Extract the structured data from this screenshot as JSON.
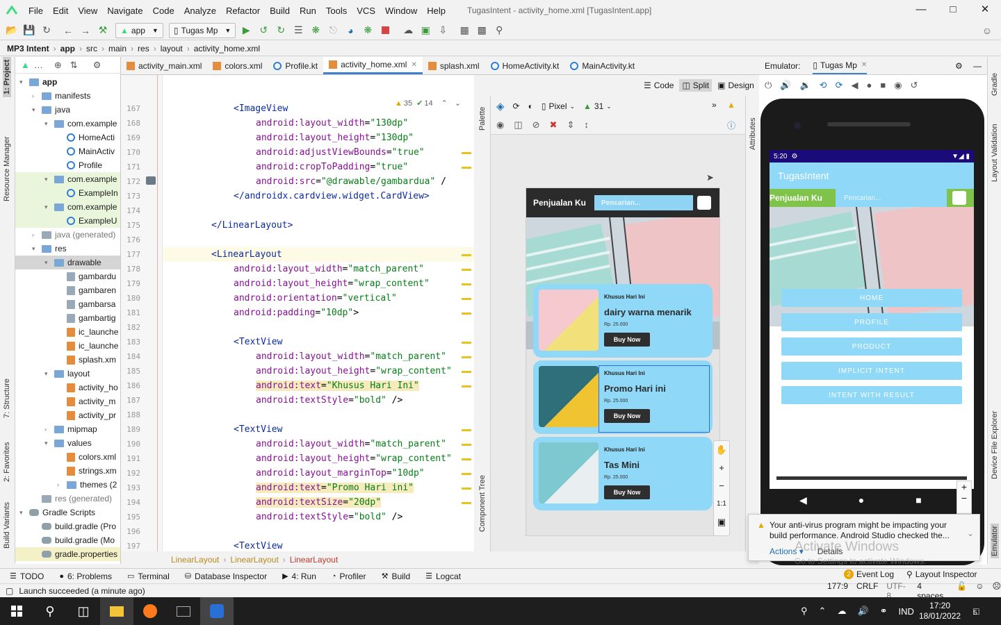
{
  "window": {
    "title": "TugasIntent - activity_home.xml [TugasIntent.app]"
  },
  "menu": [
    "File",
    "Edit",
    "View",
    "Navigate",
    "Code",
    "Analyze",
    "Refactor",
    "Build",
    "Run",
    "Tools",
    "VCS",
    "Window",
    "Help"
  ],
  "toolbar": {
    "module": "app",
    "run_config": "Tugas Mp"
  },
  "breadcrumb": [
    "MP3 Intent",
    "app",
    "src",
    "main",
    "res",
    "layout",
    "activity_home.xml"
  ],
  "left_strip": [
    "1: Project",
    "Resource Manager",
    "7: Structure",
    "2: Favorites",
    "Build Variants"
  ],
  "right_strip": [
    "Gradle",
    "Layout Validation",
    "Device File Explorer",
    "Emulator"
  ],
  "tree": [
    {
      "label": "app",
      "depth": 0,
      "kind": "fold",
      "bold": true,
      "arrow": "▾"
    },
    {
      "label": "manifests",
      "depth": 1,
      "kind": "fold",
      "arrow": "›"
    },
    {
      "label": "java",
      "depth": 1,
      "kind": "fold",
      "arrow": "▾"
    },
    {
      "label": "com.example",
      "depth": 2,
      "kind": "fold",
      "arrow": "▾"
    },
    {
      "label": "HomeActi",
      "depth": 3,
      "kind": "kt"
    },
    {
      "label": "MainActiv",
      "depth": 3,
      "kind": "kt"
    },
    {
      "label": "Profile",
      "depth": 3,
      "kind": "kt"
    },
    {
      "label": "com.example",
      "depth": 2,
      "kind": "fold",
      "arrow": "▾",
      "hl": true
    },
    {
      "label": "ExampleIn",
      "depth": 3,
      "kind": "kt",
      "hl": true
    },
    {
      "label": "com.example",
      "depth": 2,
      "kind": "fold",
      "arrow": "▾",
      "hl": true
    },
    {
      "label": "ExampleU",
      "depth": 3,
      "kind": "kt",
      "hl": true
    },
    {
      "label": "java (generated)",
      "depth": 1,
      "kind": "gray",
      "arrow": "›"
    },
    {
      "label": "res",
      "depth": 1,
      "kind": "fold",
      "arrow": "▾"
    },
    {
      "label": "drawable",
      "depth": 2,
      "kind": "fold",
      "arrow": "▾",
      "sel": true
    },
    {
      "label": "gambardu",
      "depth": 3,
      "kind": "img"
    },
    {
      "label": "gambaren",
      "depth": 3,
      "kind": "img"
    },
    {
      "label": "gambarsa",
      "depth": 3,
      "kind": "img"
    },
    {
      "label": "gambartig",
      "depth": 3,
      "kind": "img"
    },
    {
      "label": "ic_launche",
      "depth": 3,
      "kind": "xml"
    },
    {
      "label": "ic_launche",
      "depth": 3,
      "kind": "xml"
    },
    {
      "label": "splash.xm",
      "depth": 3,
      "kind": "xml"
    },
    {
      "label": "layout",
      "depth": 2,
      "kind": "fold",
      "arrow": "▾"
    },
    {
      "label": "activity_ho",
      "depth": 3,
      "kind": "xml"
    },
    {
      "label": "activity_m",
      "depth": 3,
      "kind": "xml"
    },
    {
      "label": "activity_pr",
      "depth": 3,
      "kind": "xml"
    },
    {
      "label": "mipmap",
      "depth": 2,
      "kind": "fold",
      "arrow": "›"
    },
    {
      "label": "values",
      "depth": 2,
      "kind": "fold",
      "arrow": "▾"
    },
    {
      "label": "colors.xml",
      "depth": 3,
      "kind": "xml"
    },
    {
      "label": "strings.xm",
      "depth": 3,
      "kind": "xml"
    },
    {
      "label": "themes (2",
      "depth": 3,
      "kind": "fold",
      "arrow": "›"
    },
    {
      "label": "res (generated)",
      "depth": 1,
      "kind": "gray"
    },
    {
      "label": "Gradle Scripts",
      "depth": 0,
      "kind": "gradle",
      "arrow": "▾"
    },
    {
      "label": "build.gradle (Pro",
      "depth": 1,
      "kind": "gradle"
    },
    {
      "label": "build.gradle (Mo",
      "depth": 1,
      "kind": "gradle"
    },
    {
      "label": "gradle.properties",
      "depth": 1,
      "kind": "gradle",
      "hl2": true
    }
  ],
  "tabs": [
    {
      "label": "activity_main.xml",
      "icon": "xml"
    },
    {
      "label": "colors.xml",
      "icon": "xml"
    },
    {
      "label": "Profile.kt",
      "icon": "kt"
    },
    {
      "label": "activity_home.xml",
      "icon": "xml",
      "active": true
    },
    {
      "label": "splash.xml",
      "icon": "xml"
    },
    {
      "label": "HomeActivity.kt",
      "icon": "kt"
    },
    {
      "label": "MainActivity.kt",
      "icon": "kt"
    }
  ],
  "editor_modes": {
    "code": "Code",
    "split": "Split",
    "design": "Design"
  },
  "inspection": {
    "warnings": "35",
    "ok": "14"
  },
  "code_lines": [
    {
      "n": "167",
      "indent": 12,
      "parts": [
        [
          "tag",
          "<ImageView"
        ]
      ]
    },
    {
      "n": "168",
      "indent": 16,
      "parts": [
        [
          "attr",
          "android:layout_width"
        ],
        [
          "p",
          "="
        ],
        [
          "val",
          "\"130dp\""
        ]
      ]
    },
    {
      "n": "169",
      "indent": 16,
      "parts": [
        [
          "attr",
          "android:layout_height"
        ],
        [
          "p",
          "="
        ],
        [
          "val",
          "\"130dp\""
        ]
      ]
    },
    {
      "n": "170",
      "indent": 16,
      "parts": [
        [
          "attr",
          "android:adjustViewBounds"
        ],
        [
          "p",
          "="
        ],
        [
          "val",
          "\"true\""
        ]
      ]
    },
    {
      "n": "171",
      "indent": 16,
      "parts": [
        [
          "attr",
          "android:cropToPadding"
        ],
        [
          "p",
          "="
        ],
        [
          "val",
          "\"true\""
        ]
      ]
    },
    {
      "n": "172",
      "indent": 16,
      "parts": [
        [
          "attr",
          "android:src"
        ],
        [
          "p",
          "="
        ],
        [
          "val",
          "\"@drawable/gambardua\""
        ],
        [
          "p",
          " /"
        ]
      ]
    },
    {
      "n": "173",
      "indent": 12,
      "parts": [
        [
          "tag",
          "</androidx.cardview.widget.CardView>"
        ]
      ]
    },
    {
      "n": "174",
      "indent": 0,
      "parts": []
    },
    {
      "n": "175",
      "indent": 8,
      "parts": [
        [
          "tag",
          "</LinearLayout>"
        ]
      ]
    },
    {
      "n": "176",
      "indent": 0,
      "parts": []
    },
    {
      "n": "177",
      "indent": 8,
      "parts": [
        [
          "tag",
          "<LinearLayout"
        ]
      ],
      "current": true
    },
    {
      "n": "178",
      "indent": 12,
      "parts": [
        [
          "attr",
          "android:layout_width"
        ],
        [
          "p",
          "="
        ],
        [
          "val",
          "\"match_parent\""
        ]
      ]
    },
    {
      "n": "179",
      "indent": 12,
      "parts": [
        [
          "attr",
          "android:layout_height"
        ],
        [
          "p",
          "="
        ],
        [
          "val",
          "\"wrap_content\""
        ]
      ]
    },
    {
      "n": "180",
      "indent": 12,
      "parts": [
        [
          "attr",
          "android:orientation"
        ],
        [
          "p",
          "="
        ],
        [
          "val",
          "\"vertical\""
        ]
      ]
    },
    {
      "n": "181",
      "indent": 12,
      "parts": [
        [
          "attr",
          "android:padding"
        ],
        [
          "p",
          "="
        ],
        [
          "val",
          "\"10dp\""
        ],
        [
          "p",
          ">"
        ]
      ]
    },
    {
      "n": "182",
      "indent": 0,
      "parts": []
    },
    {
      "n": "183",
      "indent": 12,
      "parts": [
        [
          "tag",
          "<TextView"
        ]
      ]
    },
    {
      "n": "184",
      "indent": 16,
      "parts": [
        [
          "attr",
          "android:layout_width"
        ],
        [
          "p",
          "="
        ],
        [
          "val",
          "\"match_parent\""
        ]
      ]
    },
    {
      "n": "185",
      "indent": 16,
      "parts": [
        [
          "attr",
          "android:layout_height"
        ],
        [
          "p",
          "="
        ],
        [
          "val",
          "\"wrap_content\""
        ]
      ]
    },
    {
      "n": "186",
      "indent": 16,
      "parts": [
        [
          "attr",
          "android:text"
        ],
        [
          "p",
          "="
        ],
        [
          "val",
          "\"Khusus Hari Ini\""
        ]
      ],
      "hl": true
    },
    {
      "n": "187",
      "indent": 16,
      "parts": [
        [
          "attr",
          "android:textStyle"
        ],
        [
          "p",
          "="
        ],
        [
          "val",
          "\"bold\""
        ],
        [
          "p",
          " />"
        ]
      ]
    },
    {
      "n": "188",
      "indent": 0,
      "parts": []
    },
    {
      "n": "189",
      "indent": 12,
      "parts": [
        [
          "tag",
          "<TextView"
        ]
      ]
    },
    {
      "n": "190",
      "indent": 16,
      "parts": [
        [
          "attr",
          "android:layout_width"
        ],
        [
          "p",
          "="
        ],
        [
          "val",
          "\"match_parent\""
        ]
      ]
    },
    {
      "n": "191",
      "indent": 16,
      "parts": [
        [
          "attr",
          "android:layout_height"
        ],
        [
          "p",
          "="
        ],
        [
          "val",
          "\"wrap_content\""
        ]
      ]
    },
    {
      "n": "192",
      "indent": 16,
      "parts": [
        [
          "attr",
          "android:layout_marginTop"
        ],
        [
          "p",
          "="
        ],
        [
          "val",
          "\"10dp\""
        ]
      ]
    },
    {
      "n": "193",
      "indent": 16,
      "parts": [
        [
          "attr",
          "android:text"
        ],
        [
          "p",
          "="
        ],
        [
          "val",
          "\"Promo Hari ini\""
        ]
      ],
      "hl": true
    },
    {
      "n": "194",
      "indent": 16,
      "parts": [
        [
          "attr",
          "android:textSize"
        ],
        [
          "p",
          "="
        ],
        [
          "val",
          "\"20dp\""
        ]
      ],
      "hl": true
    },
    {
      "n": "195",
      "indent": 16,
      "parts": [
        [
          "attr",
          "android:textStyle"
        ],
        [
          "p",
          "="
        ],
        [
          "val",
          "\"bold\""
        ],
        [
          "p",
          " />"
        ]
      ]
    },
    {
      "n": "196",
      "indent": 0,
      "parts": []
    },
    {
      "n": "197",
      "indent": 12,
      "parts": [
        [
          "tag",
          "<TextView"
        ]
      ]
    }
  ],
  "design_toolbar": {
    "device": "Pixel",
    "api": "31"
  },
  "palette_label": "Palette",
  "component_tree_label": "Component Tree",
  "attributes_label": "Attributes",
  "preview": {
    "app_title": "Penjualan Ku",
    "search_placeholder": "Pencarian...",
    "cards": [
      {
        "kicker": "Khusus Hari Ini",
        "title": "dairy warna menarik",
        "price": "Rp. 25.000",
        "button": "Buy Now"
      },
      {
        "kicker": "Khusus Hari Ini",
        "title": "Promo Hari ini",
        "price": "Rp. 25.000",
        "button": "Buy Now"
      },
      {
        "kicker": "Khusus Hari Ini",
        "title": "Tas Mini",
        "price": "Rp. 25.000",
        "button": "Buy Now"
      }
    ],
    "zoom_one": "1:1"
  },
  "emulator": {
    "label": "Emulator:",
    "tab": "Tugas Mp",
    "status_time": "5:20",
    "app_title": "TugasIntent",
    "sub_title": "Penjualan Ku",
    "search_placeholder": "Pencarian...",
    "buttons": [
      "HOME",
      "PROFILE",
      "PRODUCT",
      "IMPLICIT INTENT",
      "INTENT WITH RESULT"
    ]
  },
  "breadcrumb_path": [
    "LinearLayout",
    "LinearLayout",
    "LinearLayout"
  ],
  "bottom_tools": [
    "TODO",
    "6: Problems",
    "Terminal",
    "Database Inspector",
    "4: Run",
    "Profiler",
    "Build",
    "Logcat"
  ],
  "bottom_right": {
    "event_log": "Event Log",
    "event_count": "2",
    "layout_inspector": "Layout Inspector"
  },
  "status": {
    "message": "Launch succeeded (a minute ago)",
    "position": "177:9",
    "line_sep": "CRLF",
    "encoding": "UTF-8",
    "indent": "4 spaces"
  },
  "notification": {
    "text": "Your anti-virus program might be impacting your build performance. Android Studio checked the...",
    "actions": "Actions",
    "details": "Details",
    "watermark1": "Activate Windows",
    "watermark2": "Go to Settings to activate Windows."
  },
  "taskbar": {
    "time": "17:20",
    "date": "18/01/2022",
    "lang": "IND",
    "notif_count": "5"
  }
}
